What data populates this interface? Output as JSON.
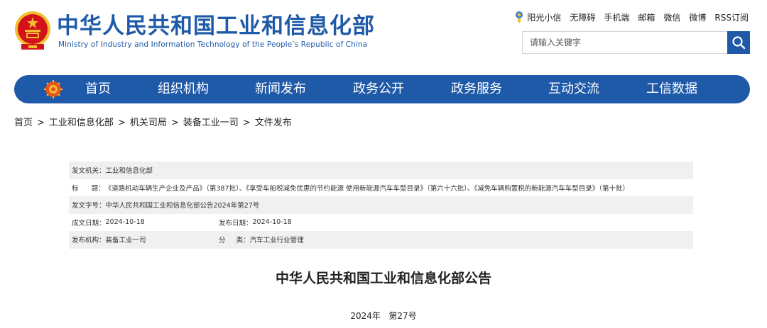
{
  "header": {
    "title_cn": "中华人民共和国工业和信息化部",
    "title_en": "Ministry of Industry and Information Technology of the People’s Republic of China",
    "links": [
      "阳光小信",
      "无障碍",
      "手机端",
      "邮箱",
      "微信",
      "微博",
      "RSS订阅"
    ],
    "link_icon": "sun-mascot-icon"
  },
  "search": {
    "placeholder": "请输入关键字",
    "button_icon": "search-icon"
  },
  "nav": {
    "items": [
      "首页",
      "组织机构",
      "新闻发布",
      "政务公开",
      "政务服务",
      "互动交流",
      "工信数据"
    ]
  },
  "breadcrumb": [
    "首页",
    "工业和信息化部",
    "机关司局",
    "装备工业一司",
    "文件发布"
  ],
  "breadcrumb_sep": ">",
  "meta": {
    "issuer_label": "发文机关：",
    "issuer": "工业和信息化部",
    "title_label": "标      题：",
    "title": "《道路机动车辆生产企业及产品》（第387批）、《享受车船税减免优惠的节约能源 使用新能源汽车车型目录》（第六十六批）、《减免车辆购置税的新能源汽车车型目录》（第十批）",
    "doc_no_label": "发文字号：",
    "doc_no": "中华人民共和国工业和信息化部公告2024年第27号",
    "date_written_label": "成文日期：",
    "date_written": "2024-10-18",
    "date_published_label": "发布日期：",
    "date_published": "2024-10-18",
    "publisher_label": "发布机构：",
    "publisher": "装备工业一司",
    "category_label": "分     类：",
    "category": "汽车工业行业管理"
  },
  "body": {
    "title": "中华人民共和国工业和信息化部公告",
    "number": "2024年   第27号"
  },
  "colors": {
    "brand_blue": "#1f5aa8",
    "row_shade": "#f0f0f0",
    "emblem_red": "#d4121b",
    "emblem_gold": "#f2c02e"
  }
}
